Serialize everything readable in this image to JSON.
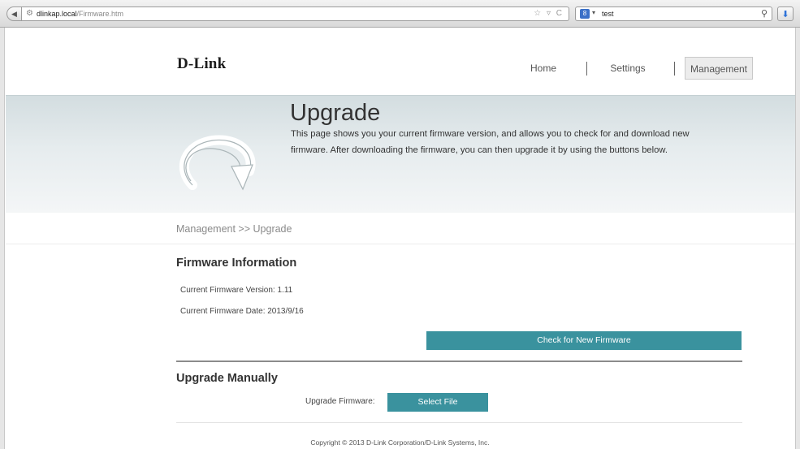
{
  "browser": {
    "url_host": "dlinkap.local",
    "url_path": "/Firmware.htm",
    "search_text": "test",
    "search_engine_badge": "8"
  },
  "header": {
    "logo": "D-Link",
    "nav": {
      "home": "Home",
      "settings": "Settings",
      "management": "Management"
    }
  },
  "banner": {
    "title": "Upgrade",
    "description": "This page shows you your current firmware version, and allows you to check for and download new firmware. After downloading the firmware, you can then upgrade it by using the buttons below."
  },
  "breadcrumb": "Management >> Upgrade",
  "firmware_info": {
    "title": "Firmware Information",
    "version_line": "Current Firmware Version: 1.11",
    "date_line": "Current Firmware Date: 2013/9/16",
    "check_button": "Check for New Firmware"
  },
  "manual": {
    "title": "Upgrade Manually",
    "label": "Upgrade Firmware:",
    "select_button": "Select File"
  },
  "footer": {
    "copyright": "Copyright © 2013 D-Link Corporation/D-Link Systems, Inc."
  },
  "colors": {
    "accent": "#3a929e",
    "banner_top": "#d3dde0"
  }
}
